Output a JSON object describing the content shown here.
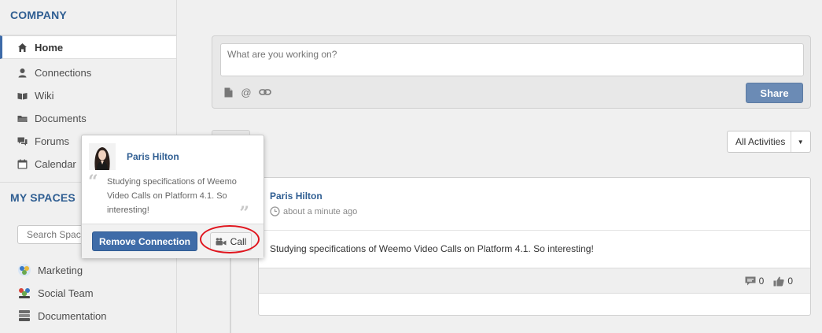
{
  "sidebar": {
    "company_title": "COMPANY",
    "nav": [
      {
        "label": "Home",
        "icon": "home-icon",
        "active": true
      },
      {
        "label": "Connections",
        "icon": "user-icon"
      },
      {
        "label": "Wiki",
        "icon": "book-icon"
      },
      {
        "label": "Documents",
        "icon": "folder-icon"
      },
      {
        "label": "Forums",
        "icon": "chat-icon"
      },
      {
        "label": "Calendar",
        "icon": "calendar-icon"
      }
    ],
    "spaces_title": "MY SPACES",
    "search_placeholder": "Search Spaces",
    "spaces": [
      {
        "label": "Marketing",
        "icon": "marketing-space-icon"
      },
      {
        "label": "Social Team",
        "icon": "social-team-space-icon"
      },
      {
        "label": "Documentation",
        "icon": "documentation-space-icon"
      }
    ]
  },
  "composer": {
    "placeholder": "What are you working on?",
    "share_label": "Share",
    "tools": [
      "file-icon",
      "mention-icon",
      "link-icon"
    ]
  },
  "filter": {
    "label": "All Activities"
  },
  "activity": {
    "author": "Paris Hilton",
    "time": "about a minute ago",
    "body": "Studying specifications of Weemo Video Calls on Platform 4.1. So interesting!",
    "comments": "0",
    "likes": "0"
  },
  "popup": {
    "name": "Paris Hilton",
    "quote": "Studying specifications of Weemo Video Calls on Platform 4.1. So interesting!",
    "remove_label": "Remove Connection",
    "call_label": "Call"
  },
  "colors": {
    "accent": "#2f5e92",
    "share": "#6b8bb5",
    "highlight": "#e0141d"
  }
}
